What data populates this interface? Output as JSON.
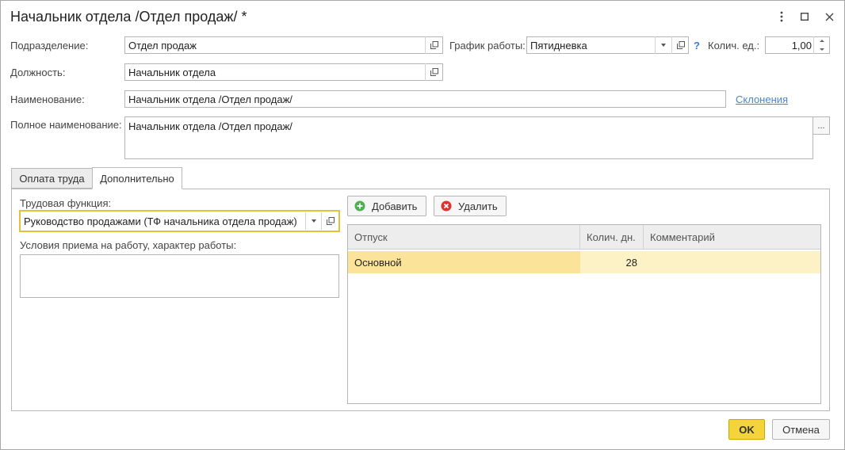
{
  "window": {
    "title": "Начальник отдела /Отдел продаж/ *",
    "controls": [
      "more-icon",
      "maximize-icon",
      "close-icon"
    ]
  },
  "form": {
    "subdivision": {
      "label": "Подразделение:",
      "value": "Отдел продаж"
    },
    "schedule": {
      "label": "График работы:",
      "value": "Пятидневка",
      "help": "?"
    },
    "units": {
      "label": "Колич. ед.:",
      "value": "1,00"
    },
    "position": {
      "label": "Должность:",
      "value": "Начальник отдела"
    },
    "name": {
      "label": "Наименование:",
      "value": "Начальник отдела /Отдел продаж/",
      "link": "Склонения"
    },
    "full_name": {
      "label": "Полное наименование:",
      "value": "Начальник отдела /Отдел продаж/",
      "btn": "..."
    }
  },
  "tabs": [
    {
      "label": "Оплата труда",
      "active": false
    },
    {
      "label": "Дополнительно",
      "active": true
    }
  ],
  "extra": {
    "labor_function": {
      "label": "Трудовая функция:",
      "value": "Руководство продажами (ТФ начальника отдела продаж)"
    },
    "conditions": {
      "label": "Условия приема на работу, характер работы:",
      "value": ""
    },
    "add_label": "Добавить",
    "delete_label": "Удалить",
    "table": {
      "columns": [
        "Отпуск",
        "Колич. дн.",
        "Комментарий"
      ],
      "rows": [
        {
          "leave": "Основной",
          "days": "28",
          "comment": ""
        }
      ]
    }
  },
  "footer": {
    "ok": "OK",
    "cancel": "Отмена"
  },
  "colors": {
    "accent": "#f5d33a",
    "focus_border": "#e2c23a",
    "row_selected": "#fbe49a",
    "row_selected_light": "#fdf2c6",
    "link": "#4a86c8"
  }
}
